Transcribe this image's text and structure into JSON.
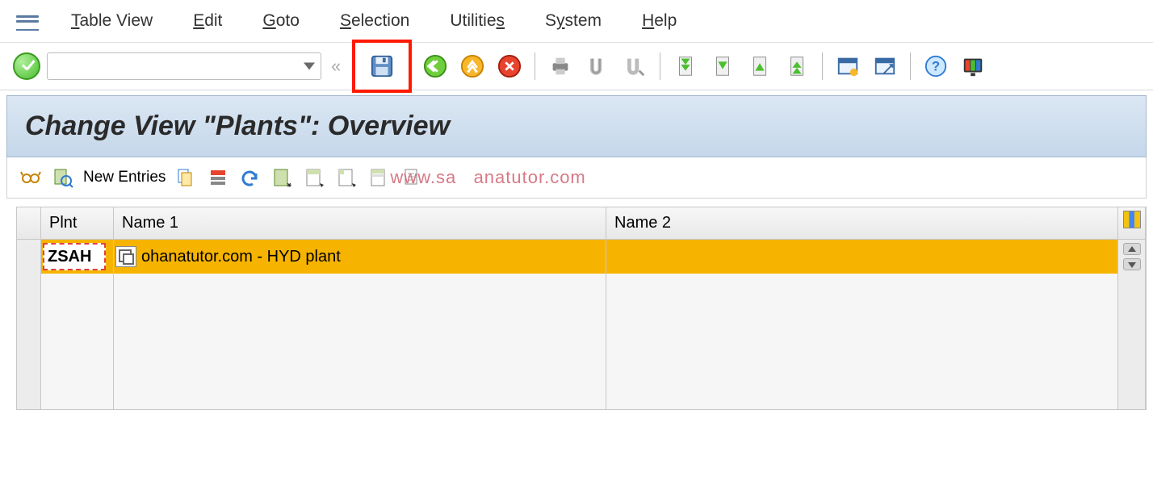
{
  "menu": {
    "items": [
      "Table View",
      "Edit",
      "Goto",
      "Selection",
      "Utilities",
      "System",
      "Help"
    ]
  },
  "toolbar": {
    "cmd_value": "",
    "cmd_placeholder": ""
  },
  "title": "Change View \"Plants\": Overview",
  "apptoolbar": {
    "new_entries": "New Entries"
  },
  "watermark_partial": "anatutor.com",
  "table": {
    "columns": {
      "plnt": "Plnt",
      "name1": "Name 1",
      "name2": "Name 2"
    },
    "rows": [
      {
        "plnt": "ZSAH",
        "name1": "ohanatutor.com - HYD plant",
        "name2": ""
      }
    ]
  }
}
